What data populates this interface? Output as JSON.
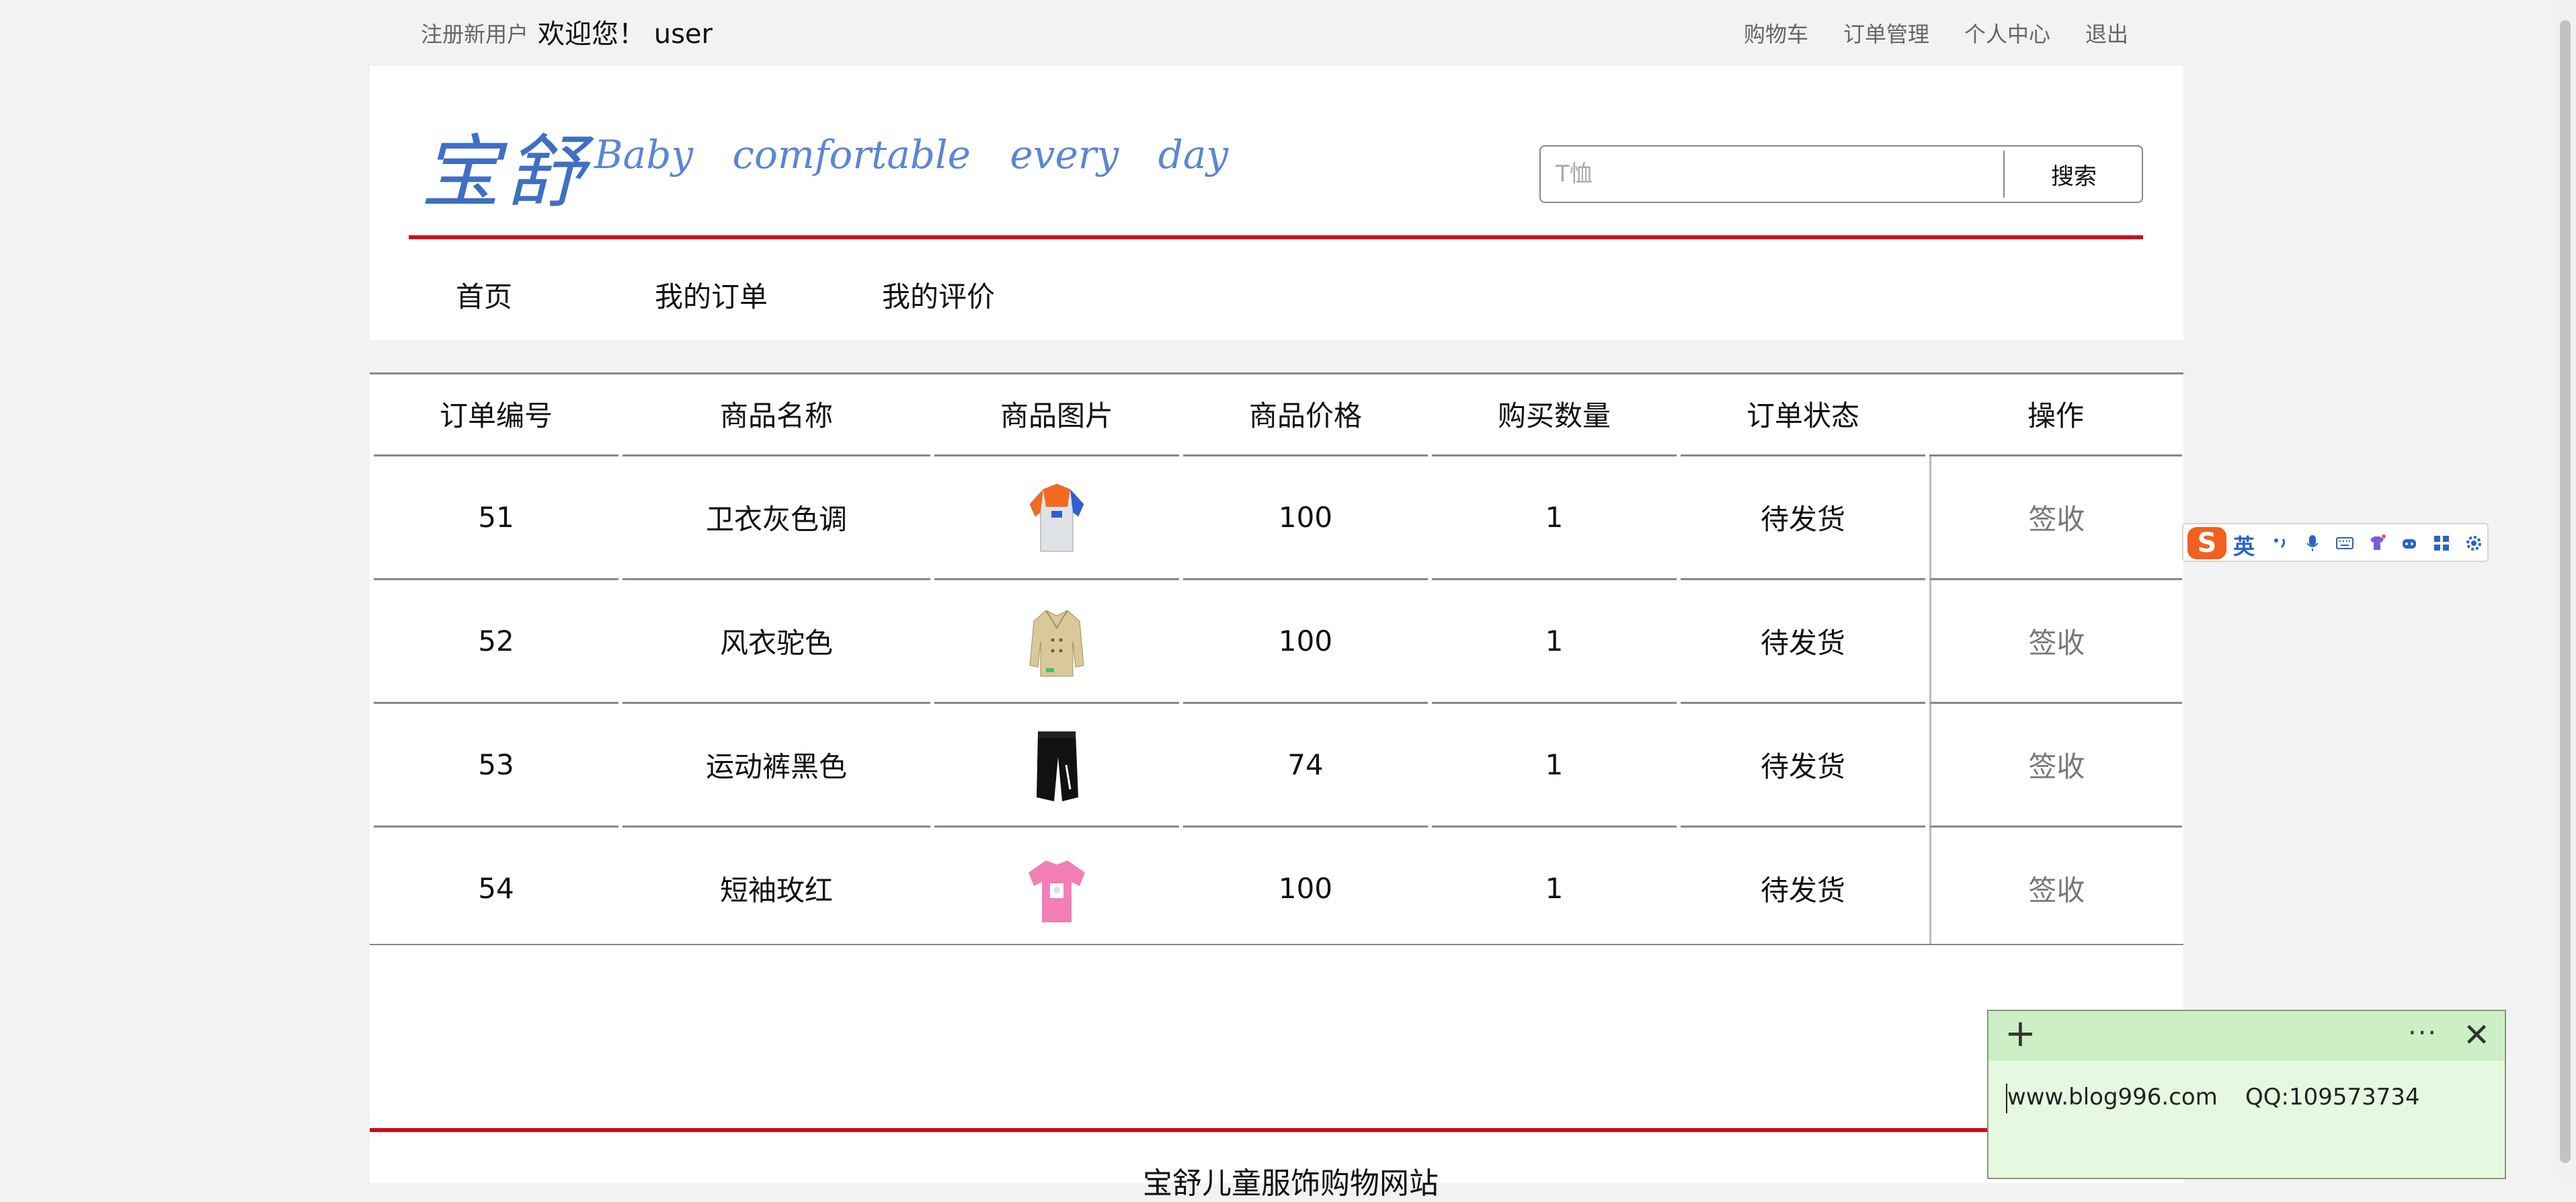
{
  "topbar": {
    "register": "注册新用户",
    "welcome": "欢迎您！ user",
    "links": [
      "购物车",
      "订单管理",
      "个人中心",
      "退出"
    ]
  },
  "header": {
    "logo_cn": "宝舒",
    "logo_en": "Baby comfortable every day",
    "search": {
      "placeholder": "T恤",
      "button": "搜索"
    }
  },
  "mainnav": [
    "首页",
    "我的订单",
    "我的评价"
  ],
  "table": {
    "headers": [
      "订单编号",
      "商品名称",
      "商品图片",
      "商品价格",
      "购买数量",
      "订单状态",
      "操作"
    ],
    "rows": [
      {
        "id": "51",
        "name": "卫衣灰色调",
        "image": "hoodie-grey-orange",
        "price": "100",
        "qty": "1",
        "status": "待发货",
        "action": "签收"
      },
      {
        "id": "52",
        "name": "风衣驼色",
        "image": "trench-coat-camel",
        "price": "100",
        "qty": "1",
        "status": "待发货",
        "action": "签收"
      },
      {
        "id": "53",
        "name": "运动裤黑色",
        "image": "sport-pants-black",
        "price": "74",
        "qty": "1",
        "status": "待发货",
        "action": "签收"
      },
      {
        "id": "54",
        "name": "短袖玫红",
        "image": "tshirt-rose-red",
        "price": "100",
        "qty": "1",
        "status": "待发货",
        "action": "签收"
      }
    ]
  },
  "footer": {
    "text": "宝舒儿童服饰购物网站"
  },
  "ime": {
    "mode": "英",
    "logo": "S"
  },
  "sticky": {
    "line1": "www.blog996.com",
    "line2": "QQ:109573734"
  },
  "colors": {
    "accent_red": "#c8101e",
    "logo_blue": "#3f6fc4",
    "sticky_bg": "#e6f8e0"
  }
}
